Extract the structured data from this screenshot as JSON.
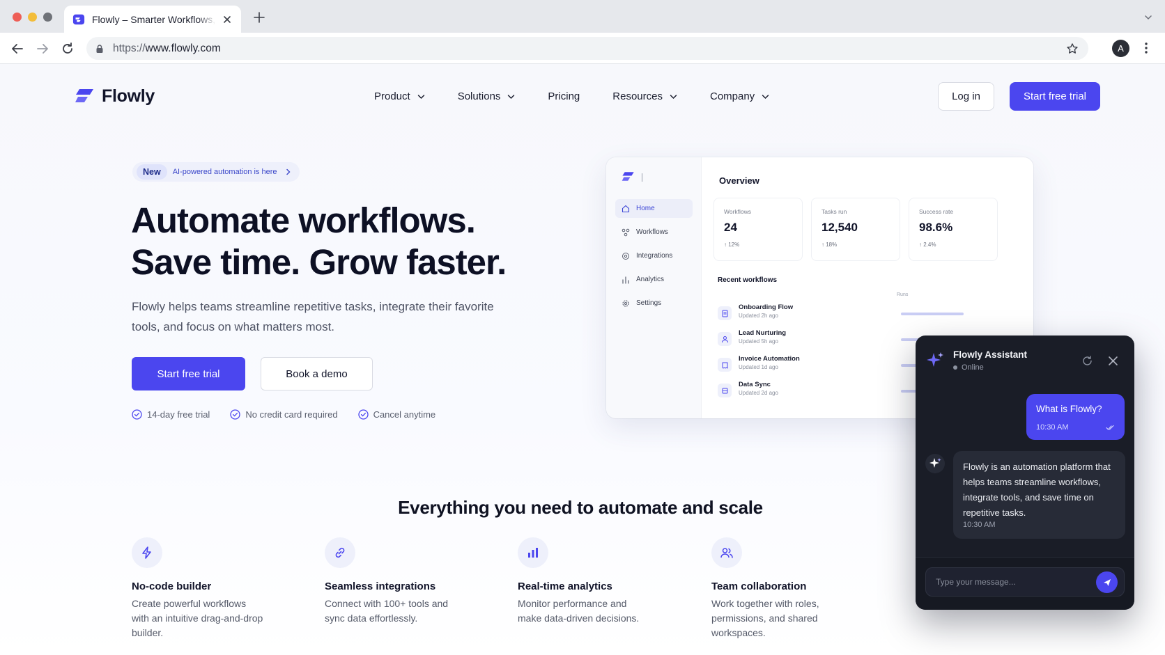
{
  "browser": {
    "tab_title": "Flowly – Smarter Workflows, Better Results",
    "url_scheme": "https://",
    "url_host": "www.flowly.com",
    "profile_initial": "A"
  },
  "header": {
    "logo_text": "Flowly",
    "nav": [
      {
        "label": "Product",
        "dropdown": true
      },
      {
        "label": "Solutions",
        "dropdown": true
      },
      {
        "label": "Pricing",
        "dropdown": false
      },
      {
        "label": "Resources",
        "dropdown": true
      },
      {
        "label": "Company",
        "dropdown": true
      }
    ],
    "login_label": "Log in",
    "trial_label": "Start free trial"
  },
  "hero": {
    "badge_new": "New",
    "badge_text": "AI-powered automation is here",
    "title_line1": "Automate workflows.",
    "title_line2": "Save time. Grow faster.",
    "subtitle": "Flowly helps teams streamline repetitive tasks, integrate their favorite tools, and focus on what matters most.",
    "primary_cta": "Start free trial",
    "secondary_cta": "Book a demo",
    "perks": [
      "14-day free trial",
      "No credit card required",
      "Cancel anytime"
    ]
  },
  "dashboard": {
    "nav": [
      "Home",
      "Workflows",
      "Integrations",
      "Analytics",
      "Settings"
    ],
    "overview_title": "Overview",
    "stats": [
      {
        "label": "Workflows",
        "value": "24",
        "delta": "↑ 12%"
      },
      {
        "label": "Tasks run",
        "value": "12,540",
        "delta": "↑ 18%"
      },
      {
        "label": "Success rate",
        "value": "98.6%",
        "delta": "↑ 2.4%"
      }
    ],
    "recent_title": "Recent workflows",
    "runs_label": "Runs",
    "workflows": [
      {
        "name": "Onboarding Flow",
        "updated": "Updated 2h ago"
      },
      {
        "name": "Lead Nurturing",
        "updated": "Updated 5h ago"
      },
      {
        "name": "Invoice Automation",
        "updated": "Updated 1d ago"
      },
      {
        "name": "Data Sync",
        "updated": "Updated 2d ago"
      }
    ]
  },
  "assistant": {
    "title": "Flowly Assistant",
    "status": "Online",
    "user_message": "What is Flowly?",
    "user_time": "10:30 AM",
    "bot_message": "Flowly is an automation platform that helps teams streamline workflows, integrate tools, and save time on repetitive tasks.",
    "bot_time": "10:30 AM",
    "input_placeholder": "Type your message..."
  },
  "features": {
    "title": "Everything you need to automate and scale",
    "items": [
      {
        "icon": "lightning-icon",
        "name": "No-code builder",
        "desc": "Create powerful workflows with an intuitive drag-and-drop builder."
      },
      {
        "icon": "link-icon",
        "name": "Seamless integrations",
        "desc": "Connect with 100+ tools and sync data effortlessly."
      },
      {
        "icon": "bar-chart-icon",
        "name": "Real-time analytics",
        "desc": "Monitor performance and make data-driven decisions."
      },
      {
        "icon": "users-icon",
        "name": "Team collaboration",
        "desc": "Work together with roles, permissions, and shared workspaces."
      }
    ]
  },
  "colors": {
    "brand": "#4b46ef",
    "chat_bg": "#1a1d27"
  }
}
